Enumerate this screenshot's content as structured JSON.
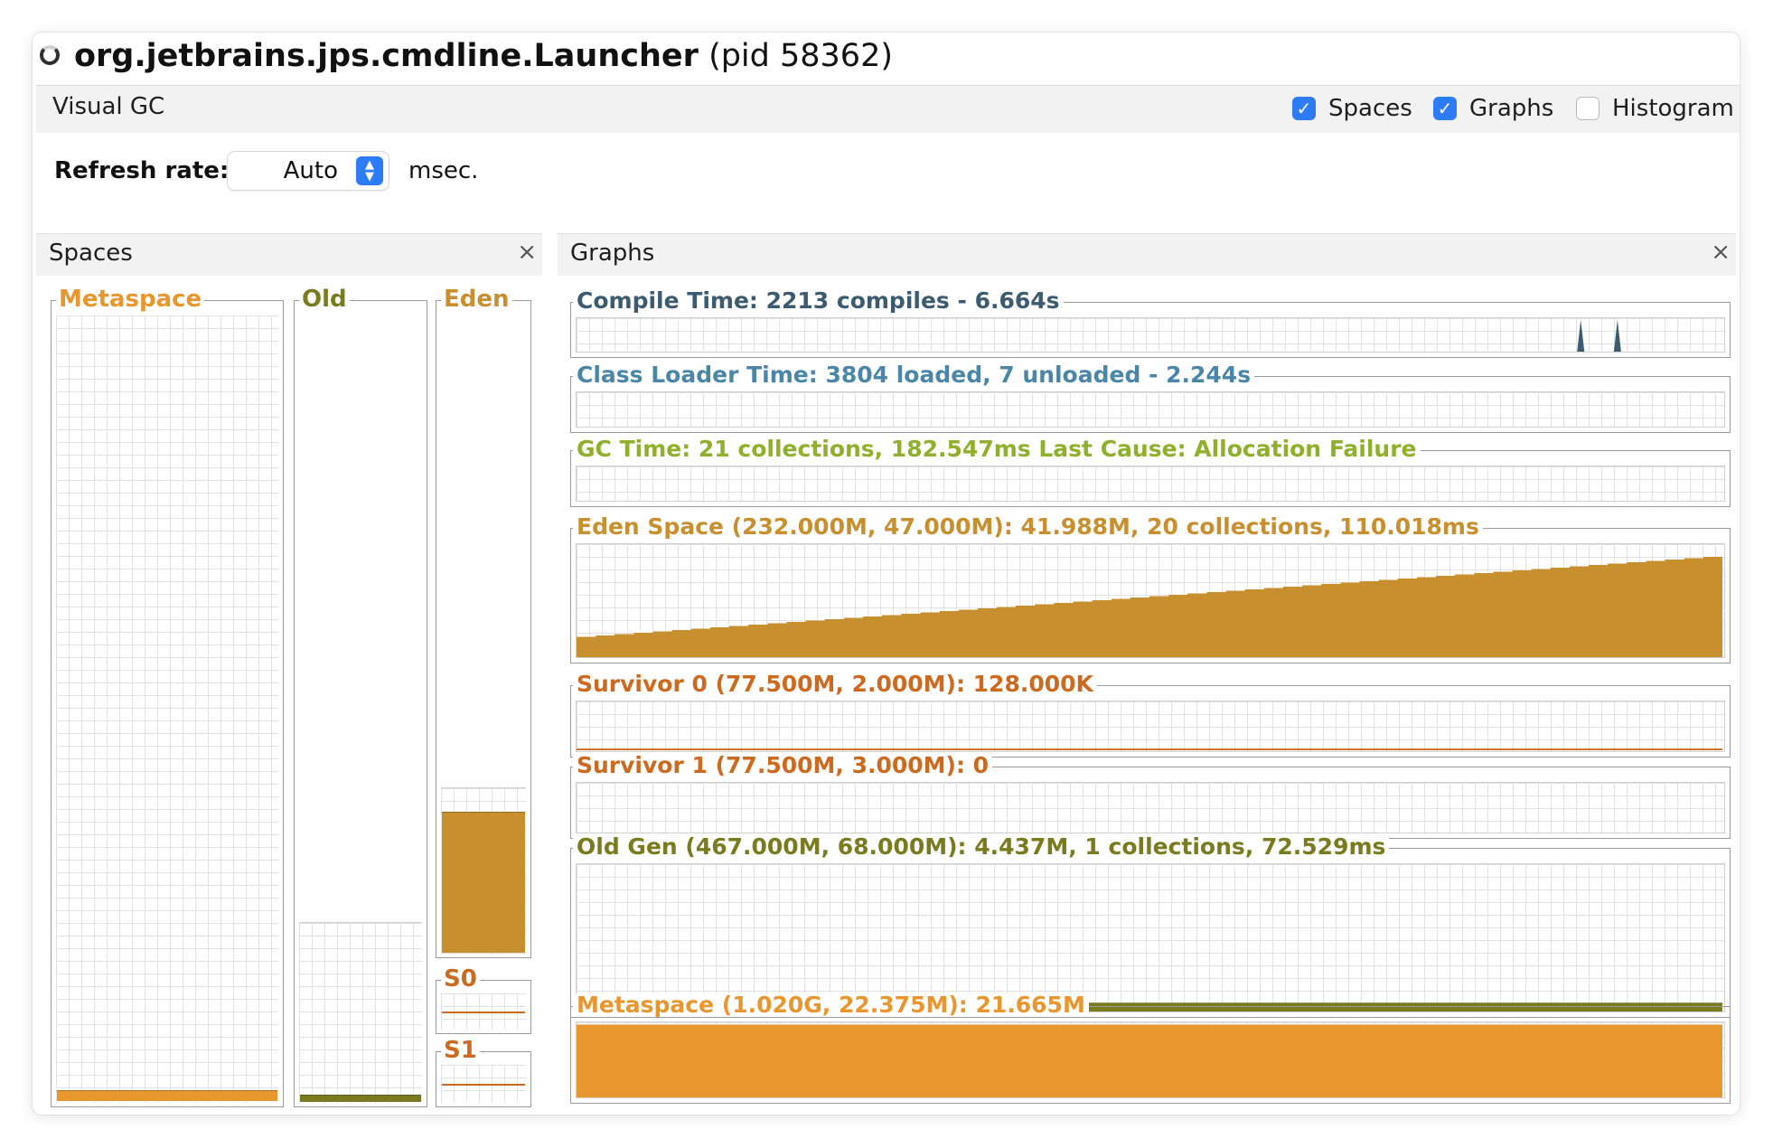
{
  "window": {
    "process_name": "org.jetbrains.jps.cmdline.Launcher",
    "pid_text": "(pid 58362)"
  },
  "tabbar": {
    "title": "Visual GC",
    "options": [
      {
        "label": "Spaces",
        "checked": true
      },
      {
        "label": "Graphs",
        "checked": true
      },
      {
        "label": "Histogram",
        "checked": false
      }
    ]
  },
  "refresh": {
    "label": "Refresh rate:",
    "value": "Auto",
    "unit": "msec."
  },
  "panels": {
    "spaces_title": "Spaces",
    "graphs_title": "Graphs",
    "close_glyph": "×"
  },
  "spaces": [
    {
      "label": "Metaspace",
      "color": "#e8962e",
      "fill_fraction": 0.013
    },
    {
      "label": "Old",
      "color": "#7a7a1f",
      "fill_fraction": 0.008
    },
    {
      "label": "Eden",
      "color": "#c88f2e",
      "fill_fraction": 0.22
    },
    {
      "label": "S0",
      "color": "#cc6a1f",
      "fill_fraction": 0.0
    },
    {
      "label": "S1",
      "color": "#cc6a1f",
      "fill_fraction": 0.0
    }
  ],
  "graphs": [
    {
      "label": "Compile Time: 2213 compiles - 6.664s",
      "color": "#3b5b70",
      "kind": "spikes",
      "spikes_at": [
        0.875,
        0.907
      ]
    },
    {
      "label": "Class Loader Time: 3804 loaded, 7 unloaded - 2.244s",
      "color": "#4a86a8",
      "kind": "empty"
    },
    {
      "label": "GC Time: 21 collections, 182.547ms Last Cause: Allocation Failure",
      "color": "#8fb02a",
      "kind": "empty"
    },
    {
      "label": "Eden Space (232.000M, 47.000M): 41.988M, 20 collections, 110.018ms",
      "color": "#c88f2e",
      "kind": "ramp",
      "start_level": 0.18,
      "end_level": 0.9
    },
    {
      "label": "Survivor 0 (77.500M, 2.000M): 128.000K",
      "color": "#cc6a1f",
      "kind": "line",
      "level": 0.03
    },
    {
      "label": "Survivor 1 (77.500M, 3.000M): 0",
      "color": "#cc6a1f",
      "kind": "empty"
    },
    {
      "label": "Old Gen (467.000M, 68.000M): 4.437M, 1 collections, 72.529ms",
      "color": "#7a7a1f",
      "kind": "flat",
      "level": 0.06
    },
    {
      "label": "Metaspace (1.020G, 22.375M): 21.665M",
      "color": "#e8962e",
      "kind": "flat",
      "level": 0.97
    }
  ]
}
